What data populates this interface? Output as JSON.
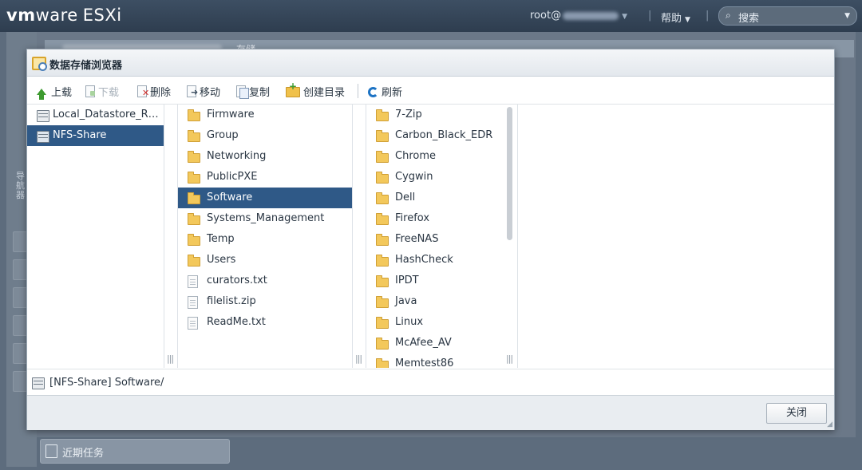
{
  "header": {
    "logo_vm": "vm",
    "logo_ware": "ware",
    "logo_product": "ESXi",
    "user": "root@",
    "help": "帮助",
    "separator": "|",
    "search_placeholder": "搜索"
  },
  "background": {
    "panel_title": "存储",
    "left_label": "导航器",
    "recent_tasks": "近期任务"
  },
  "dialog": {
    "title": "数据存储浏览器",
    "toolbar": {
      "upload": "上载",
      "download": "下载",
      "delete": "删除",
      "move": "移动",
      "copy": "复制",
      "create_dir": "创建目录",
      "refresh": "刷新"
    },
    "datastores": [
      {
        "label": "Local_Datastore_R…",
        "selected": false
      },
      {
        "label": "NFS-Share",
        "selected": true
      }
    ],
    "column2": [
      {
        "label": "Firmware",
        "type": "folder"
      },
      {
        "label": "Group",
        "type": "folder"
      },
      {
        "label": "Networking",
        "type": "folder"
      },
      {
        "label": "PublicPXE",
        "type": "folder"
      },
      {
        "label": "Software",
        "type": "folder",
        "selected": true
      },
      {
        "label": "Systems_Management",
        "type": "folder"
      },
      {
        "label": "Temp",
        "type": "folder"
      },
      {
        "label": "Users",
        "type": "folder"
      },
      {
        "label": "curators.txt",
        "type": "file"
      },
      {
        "label": "filelist.zip",
        "type": "file"
      },
      {
        "label": "ReadMe.txt",
        "type": "file"
      }
    ],
    "column3": [
      {
        "label": "7-Zip",
        "type": "folder"
      },
      {
        "label": "Carbon_Black_EDR",
        "type": "folder"
      },
      {
        "label": "Chrome",
        "type": "folder"
      },
      {
        "label": "Cygwin",
        "type": "folder"
      },
      {
        "label": "Dell",
        "type": "folder"
      },
      {
        "label": "Firefox",
        "type": "folder"
      },
      {
        "label": "FreeNAS",
        "type": "folder"
      },
      {
        "label": "HashCheck",
        "type": "folder"
      },
      {
        "label": "IPDT",
        "type": "folder"
      },
      {
        "label": "Java",
        "type": "folder"
      },
      {
        "label": "Linux",
        "type": "folder"
      },
      {
        "label": "McAfee_AV",
        "type": "folder"
      },
      {
        "label": "Memtest86",
        "type": "folder"
      }
    ],
    "grip": "|||",
    "path": "[NFS-Share] Software/",
    "close": "关闭"
  },
  "colors": {
    "selection": "#2f5987",
    "topbar": "#2e3d4f",
    "folder": "#f3c85b"
  }
}
